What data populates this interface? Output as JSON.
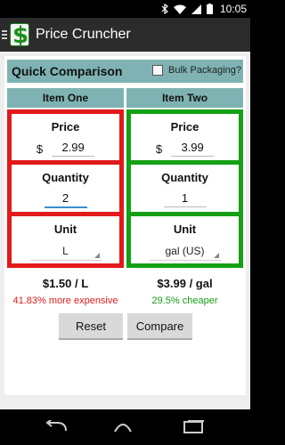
{
  "status": {
    "time": "10:05"
  },
  "app": {
    "title": "Price Cruncher",
    "logo_letter": "$"
  },
  "quick": {
    "title": "Quick Comparison",
    "bulk_label": "Bulk Packaging?"
  },
  "item_one": {
    "header": "Item One",
    "price_label": "Price",
    "currency": "$",
    "price": "2.99",
    "quantity_label": "Quantity",
    "quantity": "2",
    "unit_label": "Unit",
    "unit": "L",
    "rate": "$1.50 / L",
    "note": "41.83% more expensive"
  },
  "item_two": {
    "header": "Item Two",
    "price_label": "Price",
    "currency": "$",
    "price": "3.99",
    "quantity_label": "Quantity",
    "quantity": "1",
    "unit_label": "Unit",
    "unit": "gal (US)",
    "rate": "$3.99 / gal",
    "note": "29.5% cheaper"
  },
  "buttons": {
    "reset": "Reset",
    "compare": "Compare"
  },
  "colors": {
    "expensive": "#e11a1a",
    "cheaper": "#15a015",
    "header_bg": "#7fb3b3",
    "accent": "#3a8fd0"
  }
}
